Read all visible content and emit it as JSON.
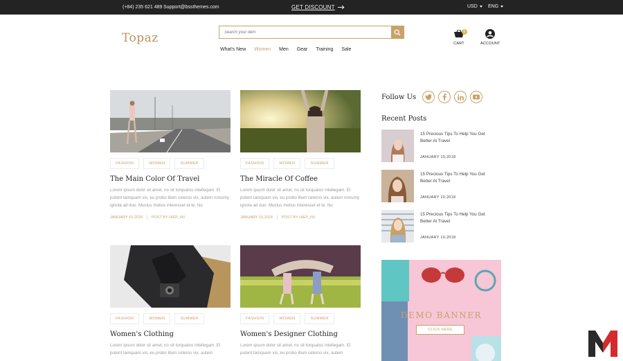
{
  "topbar": {
    "phone": "(+84) 235 621 489",
    "email": "Support@bssthemes.com",
    "discount": "GET DISCOUNT",
    "currency": "USD",
    "language": "ENG"
  },
  "header": {
    "logo": "Topaz",
    "search_placeholder": "Search your item",
    "cart_label": "CART",
    "cart_count": "0",
    "account_label": "ACCOUNT"
  },
  "nav": {
    "items": [
      "What's New",
      "Women",
      "Men",
      "Gear",
      "Training",
      "Sale"
    ],
    "active": "Women"
  },
  "posts": [
    {
      "tags": [
        "FASHION",
        "WOMEN",
        "SUMMER"
      ],
      "title": "The Main Color Of Travel",
      "excerpt": "Lorem ipsum dolor sit amet, no sit torquatos intellegam. El putent tamquam vis, eu probo illum ceteros vix, autem nonumy ignota ad duo. Mucius melius interesset et te. No",
      "date": "JANUARY 10,2018",
      "author": "POST BY HIEP_NV"
    },
    {
      "tags": [
        "FASHION",
        "WOMEN",
        "SUMMER"
      ],
      "title": "The Miracle Of Coffee",
      "excerpt": "Lorem ipsum dolor sit amet, no sit torquatos intellegam. El putent tamquam vis, eu probo illum ceteros vix, autem nonumy ignota ad duo. Mucius melius interesset et te. No",
      "date": "JANUARY 10,2018",
      "author": "POST BY HIEP_NV"
    },
    {
      "tags": [
        "FASHION",
        "WOMEN",
        "SUMMER"
      ],
      "title": "Women's Clothing",
      "excerpt": "Lorem ipsum dolor sit amet, no sit torquatos intellegam. El putent tamquam vis, eu probo illum ceteros vix, autem",
      "date": "",
      "author": ""
    },
    {
      "tags": [
        "FASHION",
        "WOMEN",
        "SUMMER"
      ],
      "title": "Women's Designer Clothing",
      "excerpt": "Lorem ipsum dolor sit amet, no sit torquatos intellegam. El putent tamquam vis, eu probo illum ceteros vix, autem",
      "date": "",
      "author": ""
    }
  ],
  "sidebar": {
    "follow_us": "Follow Us",
    "socials": [
      "twitter-icon",
      "facebook-icon",
      "linkedin-icon",
      "youtube-icon"
    ],
    "recent_posts_title": "Recent Posts",
    "recent_posts": [
      {
        "title": "15 Precious Tips To Help You Get Better At Travel",
        "date": "JANUARY 10,2018"
      },
      {
        "title": "15 Precious Tips To Help You Get Better At Travel",
        "date": "JANUARY 10,2018"
      },
      {
        "title": "15 Precious Tips To Help You Get Better At Travel",
        "date": "JANUARY 10,2018"
      }
    ],
    "banner_title": "DEMO BANNER",
    "banner_button": "CLICK HERE"
  },
  "colors": {
    "accent": "#c9a26a",
    "topbar_bg": "#232323"
  }
}
